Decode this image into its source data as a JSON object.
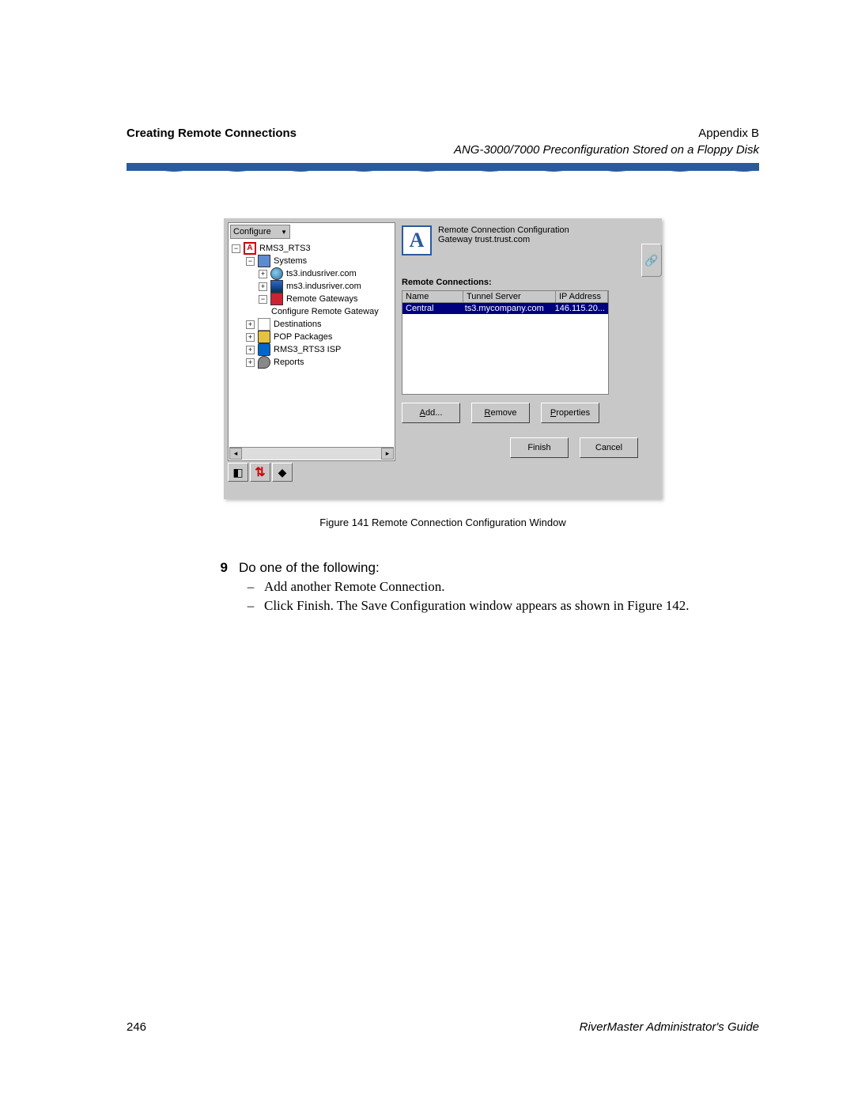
{
  "header": {
    "left": "Creating Remote Connections",
    "right": "Appendix B",
    "sub": "ANG-3000/7000 Preconfiguration Stored on a Floppy Disk"
  },
  "window": {
    "configure_dropdown": "Configure",
    "tree": {
      "root": "RMS3_RTS3",
      "systems": "Systems",
      "node_ts3": "ts3.indusriver.com",
      "node_ms3": "ms3.indusriver.com",
      "remote_gw": "Remote Gateways",
      "config_remote": "Configure Remote Gateway",
      "destinations": "Destinations",
      "pop": "POP Packages",
      "isp": "RMS3_RTS3 ISP",
      "reports": "Reports"
    },
    "right": {
      "title": "Remote Connection Configuration",
      "gateway": "Gateway  trust.trust.com",
      "section": "Remote Connections:",
      "cols": {
        "name": "Name",
        "tunnel": "Tunnel Server",
        "ip": "IP Address"
      },
      "row": {
        "name": "Central",
        "tunnel": "ts3.mycompany.com",
        "ip": "146.115.20..."
      },
      "buttons": {
        "add": "Add...",
        "remove": "Remove",
        "props": "Properties",
        "finish": "Finish",
        "cancel": "Cancel"
      }
    },
    "logo_letter": "A"
  },
  "caption": "Figure 141   Remote Connection Configuration Window",
  "step": {
    "num": "9",
    "text": "Do one of the following:",
    "b1": "Add another Remote Connection.",
    "b2": "Click Finish. The Save Configuration window appears as shown in Figure 142."
  },
  "footer": {
    "page": "246",
    "guide": "RiverMaster Administrator's Guide"
  }
}
